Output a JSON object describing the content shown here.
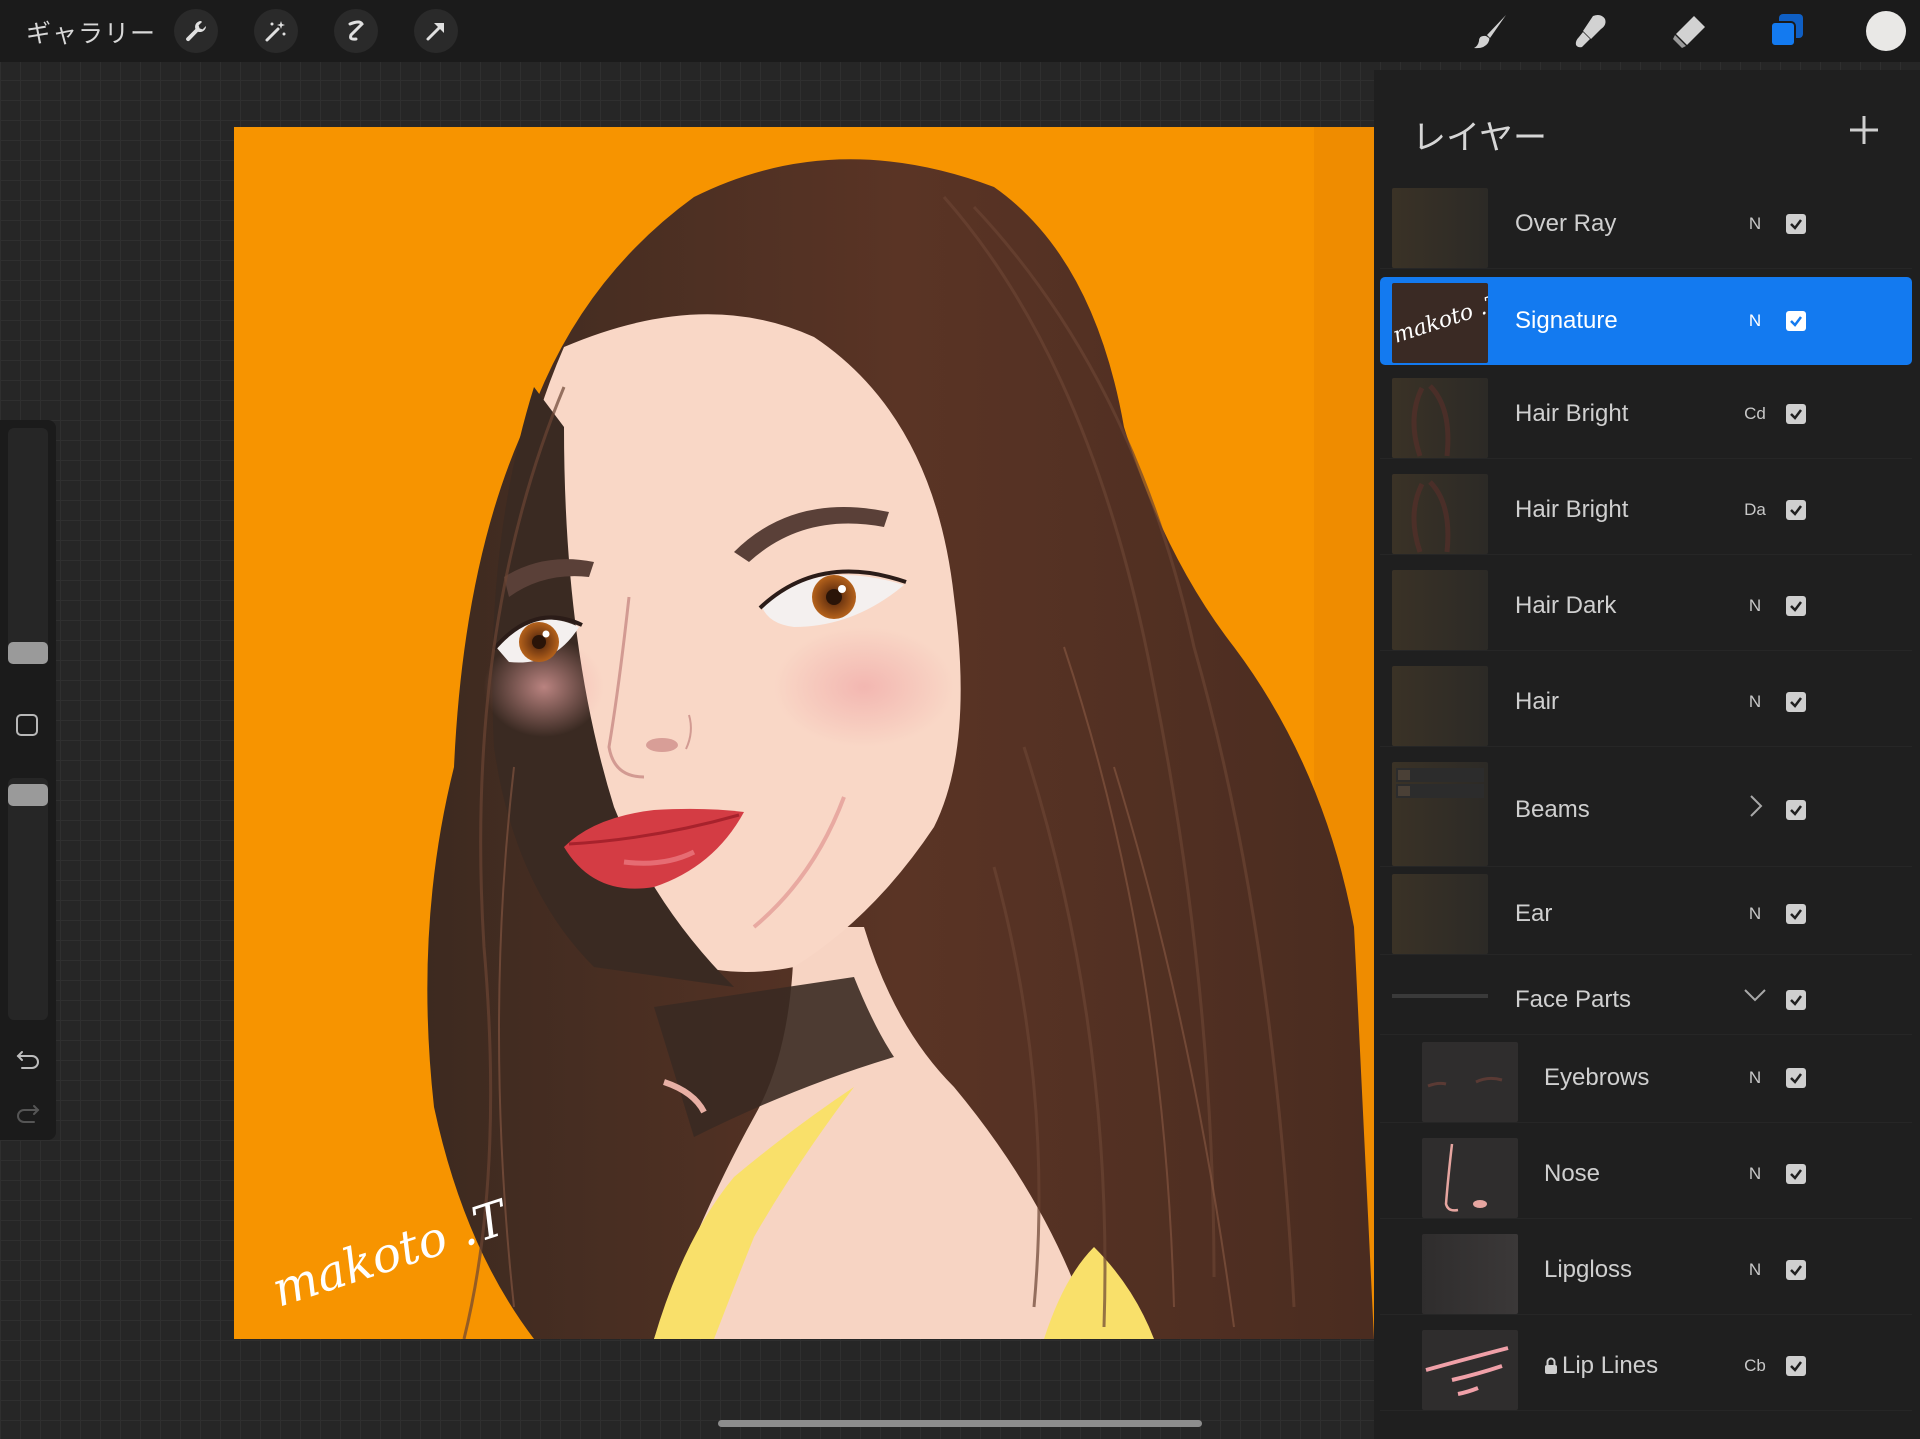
{
  "topbar": {
    "gallery_label": "ギャラリー",
    "left_tools": [
      "wrench-icon",
      "magic-wand-icon",
      "selection-icon",
      "transform-arrow-icon"
    ],
    "right_tools": [
      "brush-icon",
      "smudge-icon",
      "eraser-icon",
      "layers-icon"
    ],
    "accent_color": "#137af0",
    "current_color": "#e9e8e6"
  },
  "canvas": {
    "background_color": "#f79400",
    "signature_text": "makoto .T"
  },
  "layers_panel": {
    "title": "レイヤー",
    "layers": [
      {
        "name": "Over Ray",
        "mode": "N",
        "visible": true
      },
      {
        "name": "Signature",
        "mode": "N",
        "visible": true,
        "selected": true
      },
      {
        "name": "Hair Bright",
        "mode": "Cd",
        "visible": true
      },
      {
        "name": "Hair Bright",
        "mode": "Da",
        "visible": true
      },
      {
        "name": "Hair Dark",
        "mode": "N",
        "visible": true
      },
      {
        "name": "Hair",
        "mode": "N",
        "visible": true
      },
      {
        "name": "Beams",
        "mode": "",
        "visible": true,
        "group": "collapsed"
      },
      {
        "name": "Ear",
        "mode": "N",
        "visible": true
      },
      {
        "name": "Face Parts",
        "mode": "",
        "visible": true,
        "group": "expanded"
      },
      {
        "name": "Eyebrows",
        "mode": "N",
        "visible": true
      },
      {
        "name": "Nose",
        "mode": "N",
        "visible": true
      },
      {
        "name": "Lipgloss",
        "mode": "N",
        "visible": true
      },
      {
        "name": "Lip Lines",
        "mode": "Cb",
        "visible": true,
        "locked": true
      }
    ]
  }
}
